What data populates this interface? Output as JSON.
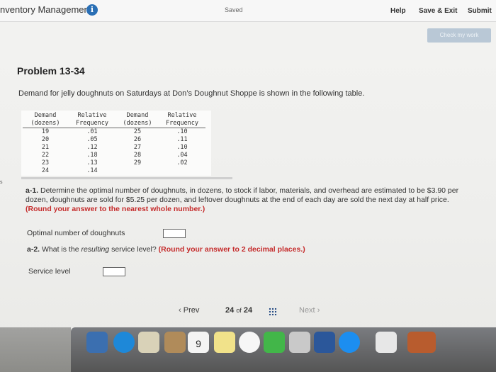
{
  "topbar": {
    "title": "nventory Management",
    "saved": "Saved",
    "help": "Help",
    "save_exit": "Save & Exit",
    "submit": "Submit",
    "check_my_work": "Check my work"
  },
  "problem": {
    "title": "Problem 13-34",
    "description": "Demand for jelly doughnuts on Saturdays at Don’s Doughnut Shoppe is shown in the following table."
  },
  "table": {
    "headers": [
      [
        "Demand",
        "(dozens)"
      ],
      [
        "Relative",
        "Frequency"
      ],
      [
        "Demand",
        "(dozens)"
      ],
      [
        "Relative",
        "Frequency"
      ]
    ],
    "rows": [
      [
        "19",
        ".01",
        "25",
        ".10"
      ],
      [
        "20",
        ".05",
        "26",
        ".11"
      ],
      [
        "21",
        ".12",
        "27",
        ".10"
      ],
      [
        "22",
        ".18",
        "28",
        ".04"
      ],
      [
        "23",
        ".13",
        "29",
        ".02"
      ],
      [
        "24",
        ".14",
        "",
        ""
      ]
    ]
  },
  "questions": {
    "a1_label": "a-1.",
    "a1_text_1": " Determine the optimal number of doughnuts, in dozens, to stock if labor, materials, and overhead are estimated to be $3.90 per",
    "a1_text_2": "dozen, doughnuts are sold for $5.25 per dozen, and leftover doughnuts at the end of each day are sold the next day at half price.",
    "a1_round": "(Round your answer to the nearest whole number.)",
    "optimal_label": "Optimal number of doughnuts",
    "a2_label": "a-2.",
    "a2_text_1": " What is the ",
    "a2_text_italic": "resulting",
    "a2_text_2": " service level? ",
    "a2_round": "(Round your answer to 2 decimal places.)",
    "service_label": "Service level"
  },
  "pager": {
    "prev": "Prev",
    "current": "24",
    "of": "of",
    "total": "24",
    "next": "Next"
  },
  "dock": {
    "calendar_day": "9"
  },
  "side_marker": "s",
  "colors": {
    "accent": "#2a6fb5",
    "warning": "#c52b2b"
  }
}
